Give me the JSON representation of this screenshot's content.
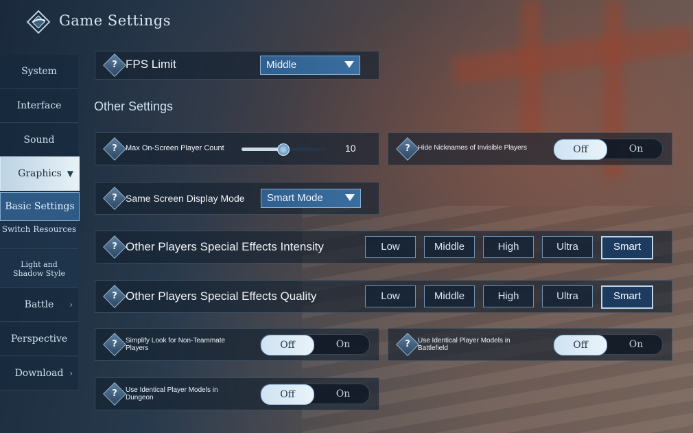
{
  "header": {
    "title": "Game Settings"
  },
  "sidebar": {
    "items": [
      {
        "label": "System"
      },
      {
        "label": "Interface"
      },
      {
        "label": "Sound"
      },
      {
        "label": "Graphics"
      },
      {
        "label": "Basic Settings"
      },
      {
        "label": "Switch Resources"
      },
      {
        "label": "Light and Shadow Style"
      },
      {
        "label": "Battle"
      },
      {
        "label": "Perspective"
      },
      {
        "label": "Download"
      }
    ]
  },
  "fps": {
    "label": "FPS Limit",
    "value": "Middle"
  },
  "other_settings_title": "Other Settings",
  "max_players": {
    "label": "Max On-Screen Player Count",
    "value": "10",
    "level": 0.48
  },
  "hide_nicknames": {
    "label": "Hide Nicknames of Invisible Players",
    "off": "Off",
    "on": "On",
    "state": "Off"
  },
  "display_mode": {
    "label": "Same Screen Display Mode",
    "value": "Smart Mode"
  },
  "effects_intensity": {
    "label": "Other Players Special Effects Intensity",
    "options": [
      "Low",
      "Middle",
      "High",
      "Ultra",
      "Smart"
    ],
    "selected": "Smart"
  },
  "effects_quality": {
    "label": "Other Players Special Effects Quality",
    "options": [
      "Low",
      "Middle",
      "High",
      "Ultra",
      "Smart"
    ],
    "selected": "Smart"
  },
  "simplify_look": {
    "label": "Simplify Look for Non-Teammate Players",
    "off": "Off",
    "on": "On",
    "state": "Off"
  },
  "identical_battlefield": {
    "label": "Use Identical Player Models in Battlefield",
    "off": "Off",
    "on": "On",
    "state": "Off"
  },
  "identical_dungeon": {
    "label": "Use Identical Player Models in Dungeon",
    "off": "Off",
    "on": "On",
    "state": "Off"
  },
  "help_glyph": "?",
  "icons": {
    "logo": "diamond-logo-icon",
    "help": "help-icon",
    "chevron": "chevron-icon"
  },
  "colors": {
    "accent": "#3a6e9e",
    "selected_sidebar": "#2e5a85"
  }
}
